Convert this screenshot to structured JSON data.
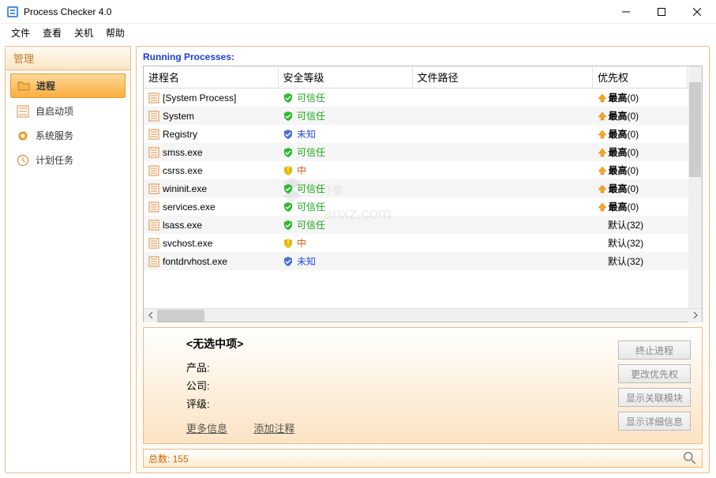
{
  "window": {
    "title": "Process Checker 4.0"
  },
  "menu": {
    "file": "文件",
    "view": "查看",
    "shutdown": "关机",
    "help": "帮助"
  },
  "sidebar": {
    "header": "管理",
    "items": [
      {
        "label": "进程",
        "icon": "folder"
      },
      {
        "label": "自启动项",
        "icon": "list"
      },
      {
        "label": "系统服务",
        "icon": "gear"
      },
      {
        "label": "计划任务",
        "icon": "clock"
      }
    ]
  },
  "main": {
    "title": "Running Processes:",
    "columns": {
      "name": "进程名",
      "security": "安全等级",
      "path": "文件路径",
      "priority": "优先权"
    },
    "security_labels": {
      "trusted": "可信任",
      "unknown": "未知",
      "medium": "中"
    },
    "priority_labels": {
      "highest": "最高",
      "default": "默认"
    },
    "rows": [
      {
        "name": "[System Process]",
        "security": "trusted",
        "priority": "highest",
        "pcount": "(0)"
      },
      {
        "name": "System",
        "security": "trusted",
        "priority": "highest",
        "pcount": "(0)"
      },
      {
        "name": "Registry",
        "security": "unknown",
        "priority": "highest",
        "pcount": "(0)"
      },
      {
        "name": "smss.exe",
        "security": "trusted",
        "priority": "highest",
        "pcount": "(0)"
      },
      {
        "name": "csrss.exe",
        "security": "medium",
        "priority": "highest",
        "pcount": "(0)"
      },
      {
        "name": "wininit.exe",
        "security": "trusted",
        "priority": "highest",
        "pcount": "(0)"
      },
      {
        "name": "services.exe",
        "security": "trusted",
        "priority": "highest",
        "pcount": "(0)"
      },
      {
        "name": "lsass.exe",
        "security": "trusted",
        "priority": "default",
        "pcount": "(32)"
      },
      {
        "name": "svchost.exe",
        "security": "medium",
        "priority": "default",
        "pcount": "(32)"
      },
      {
        "name": "fontdrvhost.exe",
        "security": "unknown",
        "priority": "default",
        "pcount": "(32)"
      }
    ]
  },
  "detail": {
    "title": "<无选中项>",
    "product_label": "产品:",
    "company_label": "公司:",
    "rating_label": "评级:",
    "more_info": "更多信息",
    "add_comment": "添加注释",
    "btn_terminate": "终止进程",
    "btn_priority": "更改优先权",
    "btn_modules": "显示关联模块",
    "btn_details": "显示详细信息"
  },
  "status": {
    "total_label": "总数:",
    "total_value": "155"
  },
  "watermark": {
    "text": "安下载",
    "sub": "anxz.com"
  }
}
